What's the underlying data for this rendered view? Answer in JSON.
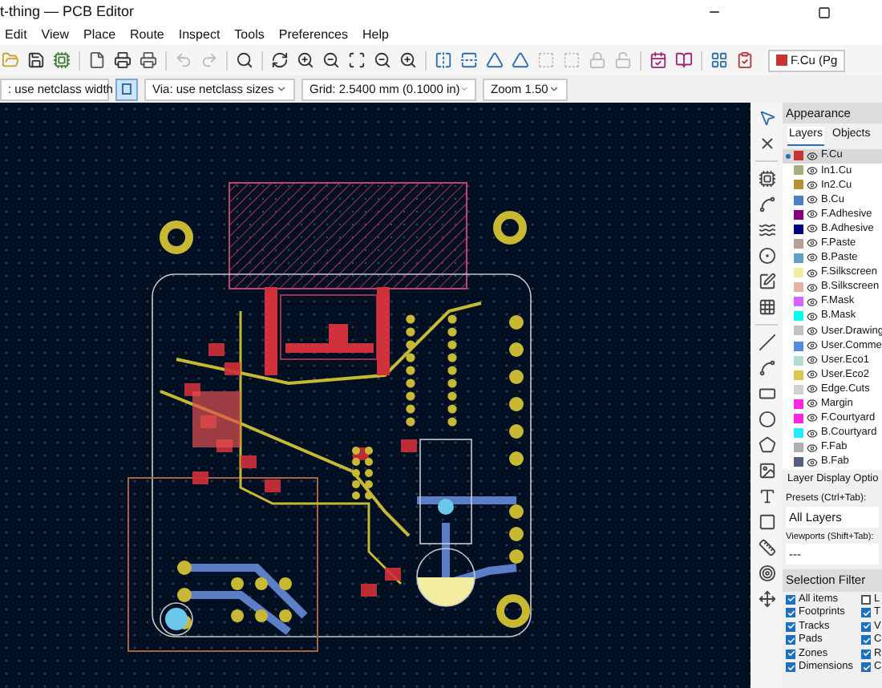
{
  "window": {
    "title": "t-thing — PCB Editor"
  },
  "menu": [
    "Edit",
    "View",
    "Place",
    "Route",
    "Inspect",
    "Tools",
    "Preferences",
    "Help"
  ],
  "toolbar": {
    "layer": "F.Cu (Pg"
  },
  "options_bar": {
    "track": ": use netclass width",
    "via": "Via: use netclass sizes",
    "grid": "Grid: 2.5400 mm (0.1000 in)",
    "zoom": "Zoom 1.50"
  },
  "appearance": {
    "title": "Appearance",
    "tabs": [
      {
        "label": "Layers",
        "selected": true
      },
      {
        "label": "Objects",
        "selected": false
      }
    ],
    "layers": [
      {
        "name": "F.Cu",
        "color": "#c83434",
        "selected": true
      },
      {
        "name": "In1.Cu",
        "color": "#a9ae7f",
        "selected": false
      },
      {
        "name": "In2.Cu",
        "color": "#b8902f",
        "selected": false
      },
      {
        "name": "B.Cu",
        "color": "#4d7fc4",
        "selected": false
      },
      {
        "name": "F.Adhesive",
        "color": "#84007c",
        "selected": false
      },
      {
        "name": "B.Adhesive",
        "color": "#000084",
        "selected": false
      },
      {
        "name": "F.Paste",
        "color": "#b4a09a",
        "selected": false
      },
      {
        "name": "B.Paste",
        "color": "#5fa0c3",
        "selected": false
      },
      {
        "name": "F.Silkscreen",
        "color": "#f2eda1",
        "selected": false
      },
      {
        "name": "B.Silkscreen",
        "color": "#e8b2a7",
        "selected": false
      },
      {
        "name": "F.Mask",
        "color": "#d864ff",
        "selected": false
      },
      {
        "name": "B.Mask",
        "color": "#02ffee",
        "selected": false
      },
      {
        "name": "User.Drawing",
        "color": "#c2c2c2",
        "selected": false
      },
      {
        "name": "User.Comme",
        "color": "#5989db",
        "selected": false
      },
      {
        "name": "User.Eco1",
        "color": "#b4dbd2",
        "selected": false
      },
      {
        "name": "User.Eco2",
        "color": "#d8c852",
        "selected": false
      },
      {
        "name": "Edge.Cuts",
        "color": "#d0d2cd",
        "selected": false
      },
      {
        "name": "Margin",
        "color": "#ff26e2",
        "selected": false
      },
      {
        "name": "F.Courtyard",
        "color": "#ff26e2",
        "selected": false
      },
      {
        "name": "B.Courtyard",
        "color": "#26e9ff",
        "selected": false
      },
      {
        "name": "F.Fab",
        "color": "#afafaf",
        "selected": false
      },
      {
        "name": "B.Fab",
        "color": "#585d84",
        "selected": false
      }
    ],
    "display_options": "Layer Display Optio",
    "presets_label": "Presets (Ctrl+Tab):",
    "preset": "All Layers",
    "viewports_label": "Viewports (Shift+Tab):",
    "viewport": "---"
  },
  "selection_filter": {
    "title": "Selection Filter",
    "items": [
      {
        "label": "All items",
        "checked": true
      },
      {
        "label": "L",
        "checked": false
      },
      {
        "label": "Footprints",
        "checked": true
      },
      {
        "label": "T",
        "checked": true
      },
      {
        "label": "Tracks",
        "checked": true
      },
      {
        "label": "V",
        "checked": true
      },
      {
        "label": "Pads",
        "checked": true
      },
      {
        "label": "C",
        "checked": true
      },
      {
        "label": "Zones",
        "checked": true
      },
      {
        "label": "R",
        "checked": true
      },
      {
        "label": "Dimensions",
        "checked": true
      },
      {
        "label": "C",
        "checked": true
      }
    ]
  }
}
